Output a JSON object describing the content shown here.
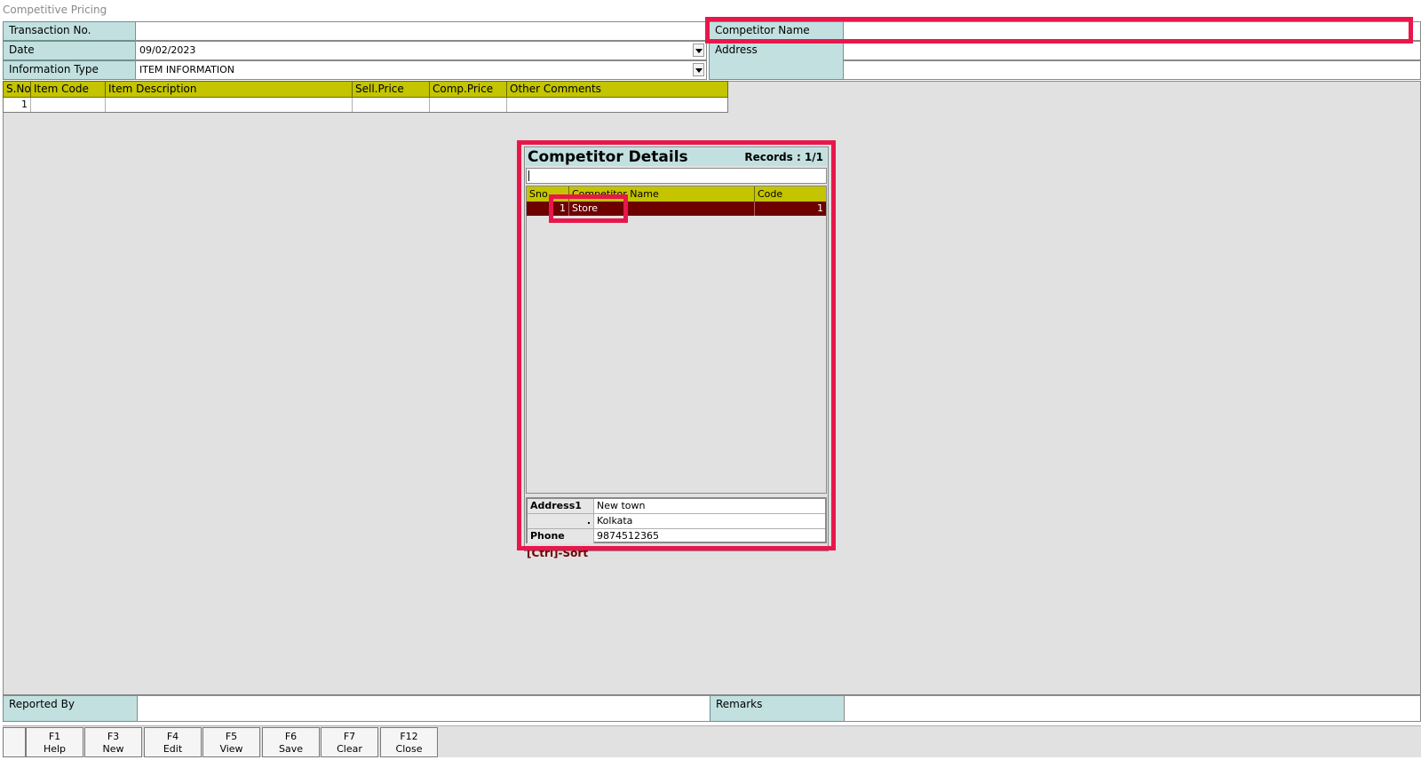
{
  "window": {
    "title": "Competitive Pricing"
  },
  "form": {
    "transaction_no": {
      "label": "Transaction No.",
      "value": ""
    },
    "date": {
      "label": "Date",
      "value": "09/02/2023"
    },
    "info_type": {
      "label": "Information Type",
      "value": "ITEM INFORMATION"
    },
    "competitor_name": {
      "label": "Competitor Name",
      "value": ""
    },
    "address": {
      "label": "Address",
      "value_line1": "",
      "value_line2": ""
    }
  },
  "item_grid": {
    "columns": [
      "S.No",
      "Item Code",
      "Item Description",
      "Sell.Price",
      "Comp.Price",
      "Other Comments"
    ],
    "rows": [
      {
        "sno": "1",
        "item_code": "",
        "item_description": "",
        "sell_price": "",
        "comp_price": "",
        "other_comments": ""
      }
    ]
  },
  "competitor_popup": {
    "title": "Competitor Details",
    "records": "Records : 1/1",
    "search_value": "",
    "columns": [
      "Sno",
      "Competitor Name",
      "Code"
    ],
    "rows": [
      {
        "sno": "1",
        "name": "Store",
        "code": "1"
      }
    ],
    "details": {
      "address1_label": "Address1",
      "address1_value": "New town",
      "address2_label": ".",
      "address2_value": "Kolkata",
      "phone_label": "Phone",
      "phone_value": "9874512365"
    },
    "sort_hint": "[Ctrl]-Sort"
  },
  "footer": {
    "reported_by": {
      "label": "Reported By",
      "value": ""
    },
    "remarks": {
      "label": "Remarks",
      "value": ""
    }
  },
  "toolbar": {
    "buttons": [
      {
        "key": "F1",
        "label": "Help"
      },
      {
        "key": "F3",
        "label": "New"
      },
      {
        "key": "F4",
        "label": "Edit"
      },
      {
        "key": "F5",
        "label": "View"
      },
      {
        "key": "F6",
        "label": "Save"
      },
      {
        "key": "F7",
        "label": "Clear"
      },
      {
        "key": "F12",
        "label": "Close"
      }
    ]
  },
  "highlight_color": "#e8174b"
}
